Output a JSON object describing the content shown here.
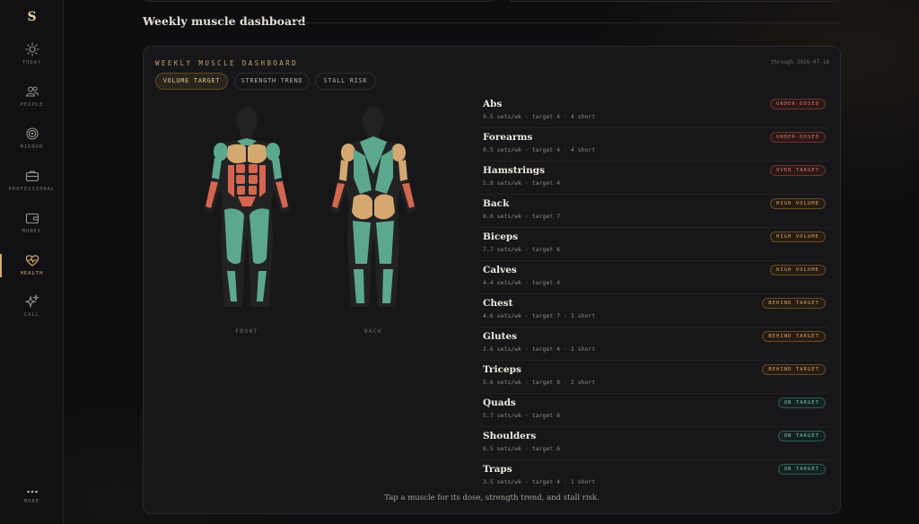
{
  "sidebar": {
    "logo": "S",
    "items": [
      {
        "label": "TODAY",
        "icon": "sun-icon"
      },
      {
        "label": "PEOPLE",
        "icon": "people-icon"
      },
      {
        "label": "MIRROR",
        "icon": "mirror-icon"
      },
      {
        "label": "PROFESSIONAL",
        "icon": "briefcase-icon"
      },
      {
        "label": "MONEY",
        "icon": "wallet-icon"
      },
      {
        "label": "HEALTH",
        "icon": "heart-pulse-icon"
      },
      {
        "label": "CALL",
        "icon": "sparkle-icon"
      }
    ],
    "more_label": "MORE",
    "active": "HEALTH"
  },
  "section": {
    "title": "Weekly muscle dashboard"
  },
  "panel": {
    "label": "WEEKLY MUSCLE DASHBOARD",
    "date": "through 2026-07-18",
    "tabs": [
      {
        "label": "VOLUME TARGET",
        "active": true
      },
      {
        "label": "STRENGTH TREND",
        "active": false
      },
      {
        "label": "STALL RISK",
        "active": false
      }
    ],
    "front_label": "FRONT",
    "back_label": "BACK",
    "hint": "Tap a muscle for its dose, strength trend, and stall risk."
  },
  "colors": {
    "accent": "#d9a86a",
    "on_target": "#5ba88e",
    "behind_target": "#d4a870",
    "under_dosed": "#d4664f",
    "body_silhouette": "#222224"
  },
  "muscles": [
    {
      "name": "Abs",
      "meta": "0.5 sets/wk · target 4 · 4 short",
      "badge": "UNDER-DOSED",
      "status": "under"
    },
    {
      "name": "Forearms",
      "meta": "0.5 sets/wk · target 4 · 4 short",
      "badge": "UNDER-DOSED",
      "status": "under"
    },
    {
      "name": "Hamstrings",
      "meta": "5.8 sets/wk · target 4",
      "badge": "OVER TARGET",
      "status": "over"
    },
    {
      "name": "Back",
      "meta": "8.6 sets/wk · target 7",
      "badge": "HIGH VOLUME",
      "status": "high"
    },
    {
      "name": "Biceps",
      "meta": "7.7 sets/wk · target 6",
      "badge": "HIGH VOLUME",
      "status": "high"
    },
    {
      "name": "Calves",
      "meta": "4.4 sets/wk · target 4",
      "badge": "HIGH VOLUME",
      "status": "high"
    },
    {
      "name": "Chest",
      "meta": "4.6 sets/wk · target 7 · 3 short",
      "badge": "BEHIND TARGET",
      "status": "behind"
    },
    {
      "name": "Glutes",
      "meta": "2.6 sets/wk · target 4 · 1 short",
      "badge": "BEHIND TARGET",
      "status": "behind"
    },
    {
      "name": "Triceps",
      "meta": "5.6 sets/wk · target 8 · 2 short",
      "badge": "BEHIND TARGET",
      "status": "behind"
    },
    {
      "name": "Quads",
      "meta": "5.7 sets/wk · target 6",
      "badge": "ON TARGET",
      "status": "on"
    },
    {
      "name": "Shoulders",
      "meta": "6.5 sets/wk · target 6",
      "badge": "ON TARGET",
      "status": "on"
    },
    {
      "name": "Traps",
      "meta": "3.5 sets/wk · target 4 · 1 short",
      "badge": "ON TARGET",
      "status": "on"
    }
  ]
}
